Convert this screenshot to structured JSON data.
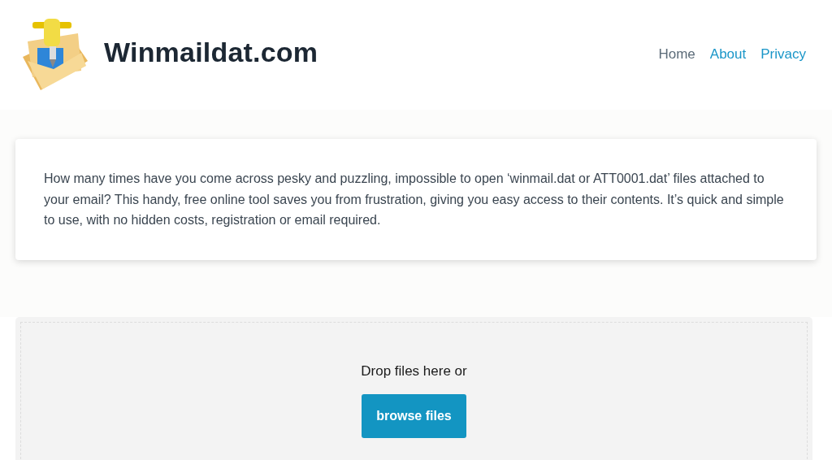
{
  "header": {
    "site_name": "Winmaildat.com",
    "nav": [
      {
        "label": "Home",
        "selected": true
      },
      {
        "label": "About",
        "selected": false
      },
      {
        "label": "Privacy",
        "selected": false
      }
    ]
  },
  "intro": {
    "text": "How many times have you come across pesky and puzzling, impossible to open ‘winmail.dat or ATT0001.dat’ files attached to your email? This handy, free online tool saves you from frustration, giving you easy access to their contents. It’s quick and simple to use, with no hidden costs, registration or email required."
  },
  "dropzone": {
    "prompt": "Drop files here or",
    "button": "browse files"
  }
}
